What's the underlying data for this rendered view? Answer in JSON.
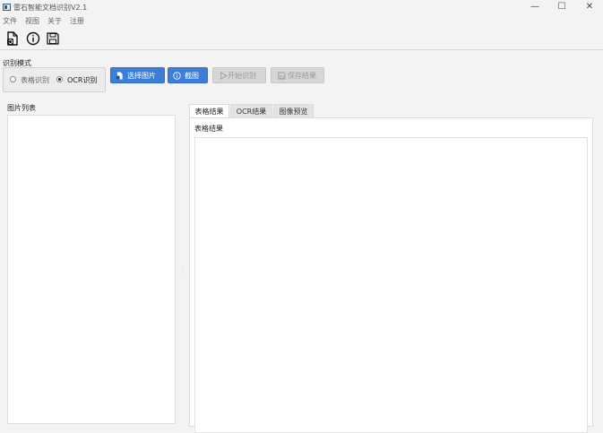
{
  "window": {
    "title": "智能文档识别V2.1",
    "title_prefix": "雷石"
  },
  "menu": [
    "文件",
    "视图",
    "关于",
    "注册"
  ],
  "toolbar_icons": [
    "open-file-icon",
    "info-icon",
    "save-icon"
  ],
  "mode": {
    "label": "识别模式",
    "options": [
      {
        "label": "表格识别",
        "selected": false
      },
      {
        "label": "OCR识别",
        "selected": true
      }
    ]
  },
  "buttons": {
    "select_image": "选择图片",
    "screenshot": "截图",
    "start_recognize": "开始识别",
    "save_result": "保存结果"
  },
  "image_list": {
    "label": "图片列表"
  },
  "tabs": [
    {
      "label": "表格结果",
      "active": true
    },
    {
      "label": "OCR结果",
      "active": false
    },
    {
      "label": "图像预览",
      "active": false
    }
  ],
  "panel": {
    "label": "表格结果"
  },
  "colors": {
    "accent": "#3d7edb",
    "disabled": "#d6d6d6",
    "background": "#f3f3f3"
  }
}
